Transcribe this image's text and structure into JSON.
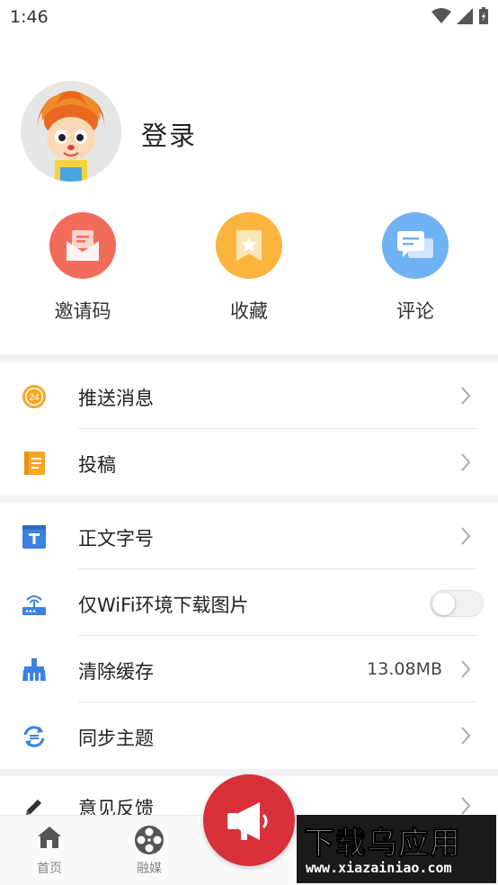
{
  "status_bar": {
    "time": "1:46"
  },
  "profile": {
    "login_label": "登录"
  },
  "quick_actions": [
    {
      "label": "邀请码",
      "icon": "mail-icon",
      "color": "#f26c5a"
    },
    {
      "label": "收藏",
      "icon": "bookmark-icon",
      "color": "#fbb53f"
    },
    {
      "label": "评论",
      "icon": "comment-icon",
      "color": "#6fb3f5"
    }
  ],
  "menu_group1": [
    {
      "title": "推送消息",
      "icon": "push-24-icon"
    },
    {
      "title": "投稿",
      "icon": "notebook-icon"
    }
  ],
  "menu_group2": [
    {
      "title": "正文字号",
      "icon": "font-size-icon"
    },
    {
      "title": "仅WiFi环境下载图片",
      "icon": "wifi-router-icon",
      "toggle_on": false
    },
    {
      "title": "清除缓存",
      "icon": "broom-icon",
      "value": "13.08MB"
    },
    {
      "title": "同步主题",
      "icon": "sync-icon"
    }
  ],
  "menu_group3": [
    {
      "title": "意见反馈",
      "icon": "pencil-icon"
    }
  ],
  "tabbar": {
    "tabs": [
      {
        "label": "首页",
        "icon": "home-icon"
      },
      {
        "label": "融媒",
        "icon": "film-reel-icon"
      }
    ]
  },
  "watermark": {
    "big": "下载乌应用",
    "small": "www.xiazainiao.com"
  },
  "colors": {
    "accent_red": "#d93039",
    "icon_blue": "#3b82e0",
    "icon_orange": "#f5a623"
  }
}
